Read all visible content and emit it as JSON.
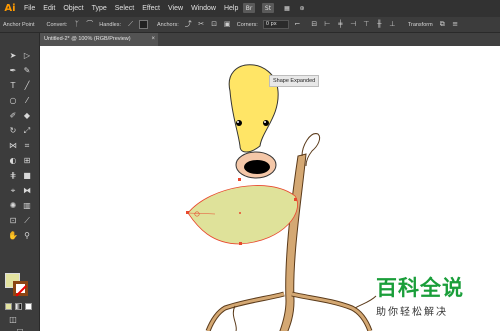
{
  "app": {
    "logo": "Ai"
  },
  "menu": [
    "File",
    "Edit",
    "Object",
    "Type",
    "Select",
    "Effect",
    "View",
    "Window",
    "Help"
  ],
  "menubar_icons": [
    "Br",
    "St"
  ],
  "control_bar": {
    "anchor_point": "Anchor Point",
    "convert": "Convert:",
    "handles": "Handles:",
    "anchors": "Anchors:",
    "corners": "Corners:",
    "corners_value": "0 px",
    "transform": "Transform"
  },
  "document_tab": {
    "title": "Untitled-2* @ 100% (RGB/Preview)",
    "close": "×"
  },
  "canvas": {
    "tooltip": "Shape Expanded"
  },
  "colors": {
    "fill": "#e3e3a0",
    "stroke": "#8b4513",
    "head": "#ffe566",
    "leaf": "#dfe29a",
    "stem": "#d4a873",
    "selection": "#e8482e"
  },
  "toolbox_icons": [
    "selection-icon",
    "direct-selection-icon",
    "pen-icon",
    "curvature-icon",
    "type-icon",
    "line-icon",
    "ellipse-icon",
    "paintbrush-icon",
    "pencil-icon",
    "eraser-icon",
    "rotate-icon",
    "scale-icon",
    "width-icon",
    "free-transform-icon",
    "shape-builder-icon",
    "perspective-icon",
    "mesh-icon",
    "gradient-icon",
    "eyedropper-icon",
    "blend-icon",
    "symbol-sprayer-icon",
    "graph-icon",
    "artboard-icon",
    "slice-icon",
    "hand-icon",
    "zoom-icon"
  ],
  "watermark": {
    "title": "百科全说",
    "subtitle": "助你轻松解决"
  }
}
